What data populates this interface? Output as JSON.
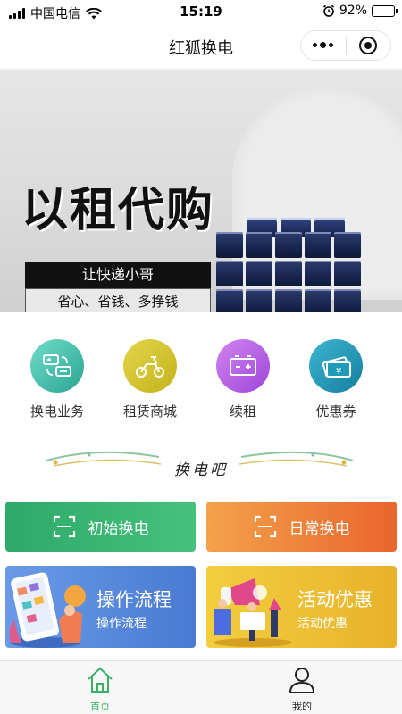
{
  "status_bar": {
    "carrier": "中国电信",
    "time": "15:19",
    "battery": "92%",
    "battery_level": 0.92
  },
  "navbar": {
    "title": "红狐换电"
  },
  "banner": {
    "headline": "以租代购",
    "label_1": "让快递小哥",
    "label_2": "省心、省钱、多挣钱",
    "page_count": 3,
    "active_index": 2
  },
  "quick_menu": [
    {
      "label": "换电业务",
      "color": "#3dbda6",
      "icon": "battery-swap-icon"
    },
    {
      "label": "租赁商城",
      "color": "#d4c52b",
      "icon": "scooter-icon"
    },
    {
      "label": "续租",
      "color": "#b65ce0",
      "icon": "battery-icon"
    },
    {
      "label": "优惠券",
      "color": "#1f9ab8",
      "icon": "coupon-icon"
    }
  ],
  "section_title": "换电吧",
  "actions": {
    "initial_swap": {
      "label": "初始换电",
      "color": "#39b56f"
    },
    "daily_swap": {
      "label": "日常换电",
      "color": "#ef7a36"
    }
  },
  "promo_cards": {
    "process": {
      "title": "操作流程",
      "subtitle": "操作流程",
      "color": "#5083d8"
    },
    "activity": {
      "title": "活动优惠",
      "subtitle": "活动优惠",
      "color": "#ecbb2e"
    }
  },
  "tabbar": [
    {
      "label": "首页",
      "icon": "home-icon",
      "active": true
    },
    {
      "label": "我的",
      "icon": "user-icon",
      "active": false
    }
  ]
}
